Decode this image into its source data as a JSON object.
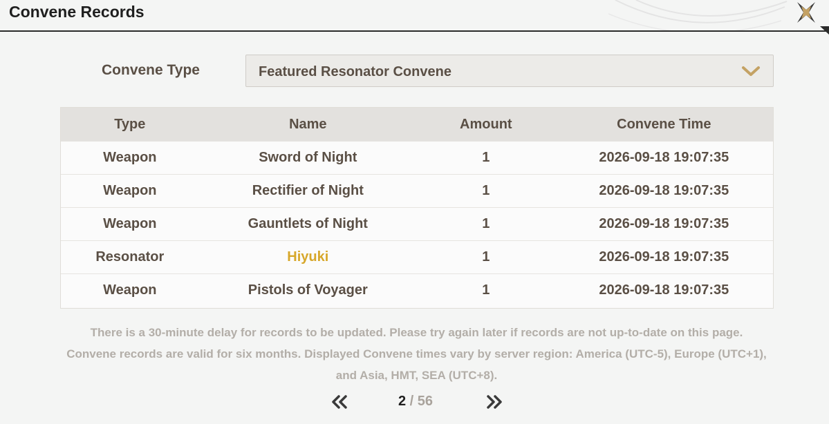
{
  "header": {
    "title": "Convene Records",
    "close_icon": "close-x-icon"
  },
  "filter": {
    "label": "Convene Type",
    "selected": "Featured Resonator Convene",
    "icon": "chevron-down-icon",
    "accent": "#c4a264"
  },
  "table": {
    "columns": [
      "Type",
      "Name",
      "Amount",
      "Convene Time"
    ],
    "rows": [
      {
        "type": "Weapon",
        "name": "Sword of Night",
        "amount": "1",
        "time": "2026-09-18 19:07:35"
      },
      {
        "type": "Weapon",
        "name": "Rectifier of Night",
        "amount": "1",
        "time": "2026-09-18 19:07:35"
      },
      {
        "type": "Weapon",
        "name": "Gauntlets of Night",
        "amount": "1",
        "time": "2026-09-18 19:07:35"
      },
      {
        "type": "Resonator",
        "name": "Hiyuki",
        "amount": "1",
        "time": "2026-09-18 19:07:35",
        "highlight": "#d7a72a"
      },
      {
        "type": "Weapon",
        "name": "Pistols of Voyager",
        "amount": "1",
        "time": "2026-09-18 19:07:35"
      }
    ]
  },
  "notes": [
    "There is a 30-minute delay for records to be updated. Please try again later if records are not up-to-date on this page.",
    "Convene records are valid for six months. Displayed Convene times vary by server region: America (UTC-5), Europe (UTC+1),",
    "and Asia, HMT, SEA (UTC+8)."
  ],
  "pagination": {
    "current": "2",
    "separator": " / ",
    "total": "56",
    "prev_icon": "double-chevron-left-icon",
    "next_icon": "double-chevron-right-icon"
  }
}
